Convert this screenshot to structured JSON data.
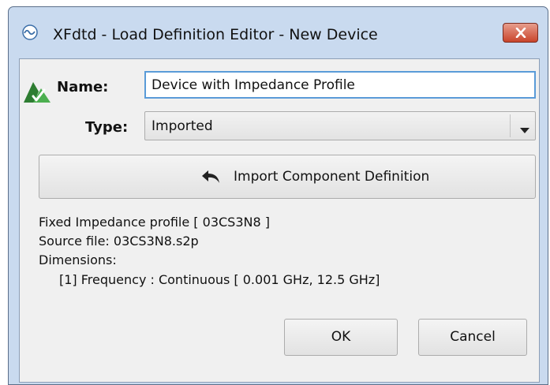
{
  "window": {
    "title": "XFdtd - Load Definition Editor - New Device",
    "icons": {
      "app": "xfdtd-app-icon",
      "close": "close-icon",
      "logo": "remcom-logo-icon"
    },
    "close_color": "#c9442b"
  },
  "form": {
    "name_label": "Name:",
    "name_value": "Device with Impedance Profile",
    "type_label": "Type:",
    "type_value": "Imported",
    "type_dropdown_icon": "chevron-down-icon"
  },
  "import_button": {
    "label": "Import Component Definition",
    "icon": "undo-arrow-icon"
  },
  "info": {
    "line1": "Fixed Impedance profile [ 03CS3N8 ]",
    "line2": "Source file: 03CS3N8.s2p",
    "line3": "Dimensions:",
    "line4": "   [1] Frequency : Continuous [ 0.001 GHz, 12.5 GHz]"
  },
  "buttons": {
    "ok": "OK",
    "cancel": "Cancel"
  }
}
